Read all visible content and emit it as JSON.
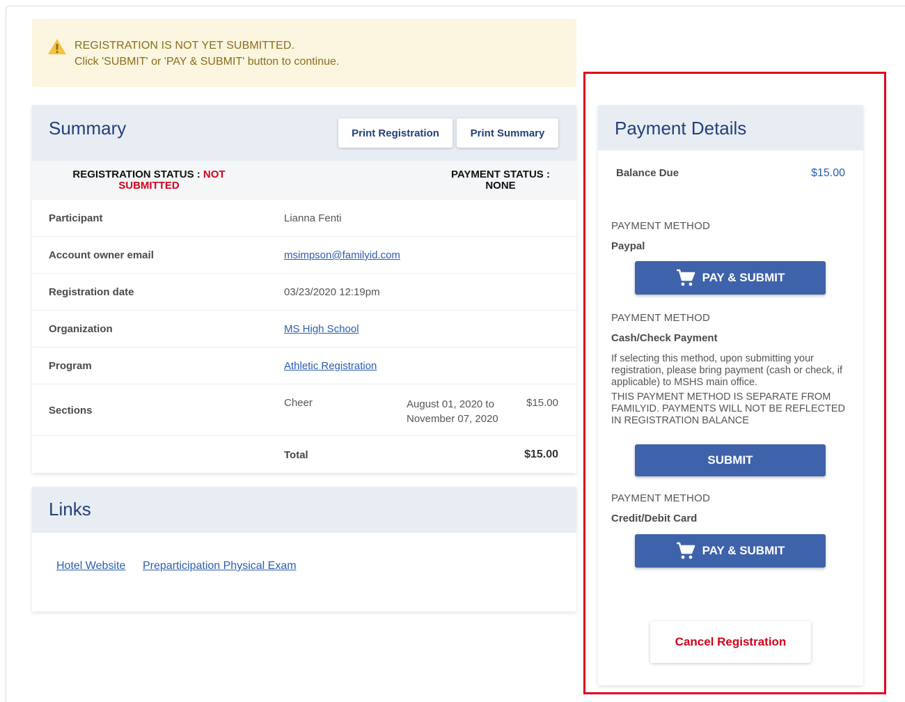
{
  "alert": {
    "line1": "REGISTRATION IS NOT YET SUBMITTED.",
    "line2": "Click 'SUBMIT' or 'PAY & SUBMIT' button to continue.",
    "icon": "warning-icon",
    "color": "#8a6d1c",
    "background": "#fcf6e0"
  },
  "summary": {
    "title": "Summary",
    "print_registration": "Print Registration",
    "print_summary": "Print Summary",
    "registration_status_label": "REGISTRATION STATUS : ",
    "registration_status_value_1": "NOT",
    "registration_status_value_2": "SUBMITTED",
    "payment_status_label": "PAYMENT STATUS :",
    "payment_status_value": "NONE",
    "rows": [
      {
        "label": "Participant",
        "value": "Lianna Fenti"
      },
      {
        "label": "Account owner email",
        "value": "msimpson@familyid.com"
      },
      {
        "label": "Registration date",
        "value": "03/23/2020 12:19pm"
      },
      {
        "label": "Organization",
        "value": "MS High School"
      },
      {
        "label": "Program",
        "value": "Athletic Registration"
      }
    ],
    "sections": {
      "label": "Sections",
      "name": "Cheer",
      "dates_line1": "August 01, 2020 to",
      "dates_line2": "November 07, 2020",
      "amount": "$15.00"
    },
    "total_label": "Total",
    "total_amount": "$15.00"
  },
  "links": {
    "title": "Links",
    "items": [
      "Hotel Website",
      "Preparticipation Physical Exam"
    ]
  },
  "payment": {
    "title": "Payment Details",
    "balance_label": "Balance Due",
    "balance_value": "$15.00",
    "methods": [
      {
        "heading": "PAYMENT METHOD",
        "name": "Paypal",
        "button": "PAY & SUBMIT"
      },
      {
        "heading": "PAYMENT METHOD",
        "name": "Cash/Check Payment",
        "button": "SUBMIT",
        "description": "If selecting this method, upon submitting your registration, please bring payment (cash or check, if applicable) to MSHS main office.",
        "notice": "THIS PAYMENT METHOD IS SEPARATE FROM FAMILYID. PAYMENTS WILL NOT BE REFLECTED IN REGISTRATION BALANCE"
      },
      {
        "heading": "PAYMENT METHOD",
        "name": "Credit/Debit Card",
        "button": "PAY & SUBMIT"
      }
    ],
    "cancel_button": "Cancel Registration",
    "cart_icon": "cart-icon"
  },
  "colors": {
    "brand_blue": "#3e63ab",
    "title_blue": "#23407a",
    "link_blue": "#2a5db0",
    "alert_red": "#d0021b",
    "highlight_red": "#e0001b"
  }
}
